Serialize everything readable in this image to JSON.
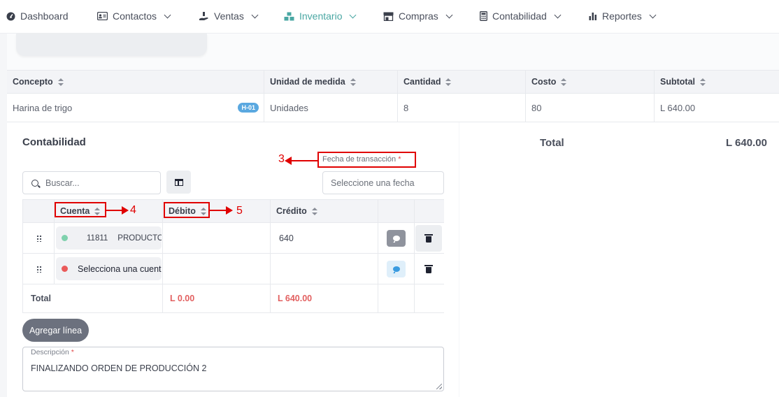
{
  "nav": {
    "items": [
      {
        "label": "Dashboard",
        "icon": "dashboard-icon",
        "dropdown": false
      },
      {
        "label": "Contactos",
        "icon": "contacts-card-icon",
        "dropdown": true
      },
      {
        "label": "Ventas",
        "icon": "sales-hand-icon",
        "dropdown": true
      },
      {
        "label": "Inventario",
        "icon": "inventory-boxes-icon",
        "dropdown": true,
        "active": true
      },
      {
        "label": "Compras",
        "icon": "store-icon",
        "dropdown": true
      },
      {
        "label": "Contabilidad",
        "icon": "calculator-icon",
        "dropdown": true
      },
      {
        "label": "Reportes",
        "icon": "bar-chart-icon",
        "dropdown": true
      }
    ],
    "active_color": "#4aa7a3"
  },
  "products_table": {
    "headers": [
      "Concepto",
      "Unidad de medida",
      "Cantidad",
      "Costo",
      "Subtotal"
    ],
    "rows": [
      {
        "concepto": "Harina de trigo",
        "badge": "H-01",
        "unidad": "Unidades",
        "cantidad": "8",
        "costo": "80",
        "subtotal": "L 640.00"
      }
    ]
  },
  "summary": {
    "total_label": "Total",
    "total_value": "L 640.00"
  },
  "accounting": {
    "title": "Contabilidad",
    "date_label": "Fecha de transacción",
    "required_mark": "*",
    "date_placeholder": "Seleccione una fecha",
    "search_placeholder": "Buscar...",
    "headers": [
      "Cuenta",
      "Débito",
      "Crédito"
    ],
    "rows": [
      {
        "account_code": "11811",
        "account_name": "PRODUCTOS TERMINADOS",
        "dot_color": "#7fd1ad",
        "debit": "",
        "credit": "640"
      },
      {
        "account_placeholder": "Selecciona una cuenta",
        "dot_color": "#ea5a5a",
        "debit": "",
        "credit": ""
      }
    ],
    "total_label": "Total",
    "total_debit": "L 0.00",
    "total_credit": "L 640.00",
    "add_line_label": "Agregar línea",
    "description_label": "Descripción",
    "description_value": "FINALIZANDO ORDEN DE PRODUCCIÓN 2"
  },
  "annotations": {
    "fecha": "3",
    "cuenta": "4",
    "debito": "5",
    "color": "#e00000"
  }
}
